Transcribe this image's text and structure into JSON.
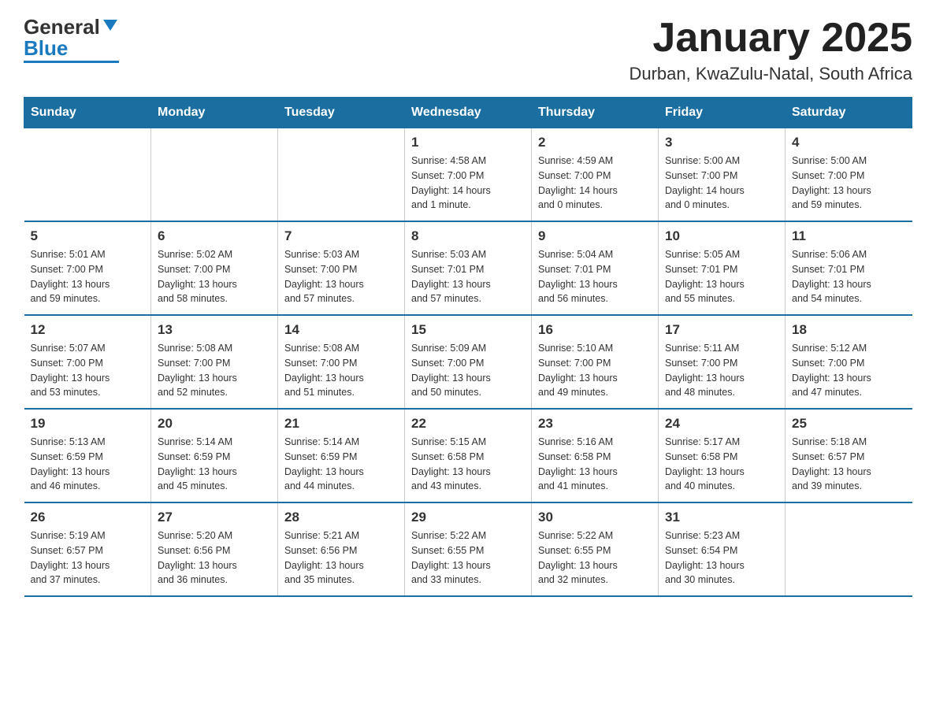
{
  "header": {
    "logo_text_general": "General",
    "logo_text_blue": "Blue",
    "title": "January 2025",
    "subtitle": "Durban, KwaZulu-Natal, South Africa"
  },
  "days_of_week": [
    "Sunday",
    "Monday",
    "Tuesday",
    "Wednesday",
    "Thursday",
    "Friday",
    "Saturday"
  ],
  "weeks": [
    [
      {
        "day": "",
        "info": ""
      },
      {
        "day": "",
        "info": ""
      },
      {
        "day": "",
        "info": ""
      },
      {
        "day": "1",
        "info": "Sunrise: 4:58 AM\nSunset: 7:00 PM\nDaylight: 14 hours\nand 1 minute."
      },
      {
        "day": "2",
        "info": "Sunrise: 4:59 AM\nSunset: 7:00 PM\nDaylight: 14 hours\nand 0 minutes."
      },
      {
        "day": "3",
        "info": "Sunrise: 5:00 AM\nSunset: 7:00 PM\nDaylight: 14 hours\nand 0 minutes."
      },
      {
        "day": "4",
        "info": "Sunrise: 5:00 AM\nSunset: 7:00 PM\nDaylight: 13 hours\nand 59 minutes."
      }
    ],
    [
      {
        "day": "5",
        "info": "Sunrise: 5:01 AM\nSunset: 7:00 PM\nDaylight: 13 hours\nand 59 minutes."
      },
      {
        "day": "6",
        "info": "Sunrise: 5:02 AM\nSunset: 7:00 PM\nDaylight: 13 hours\nand 58 minutes."
      },
      {
        "day": "7",
        "info": "Sunrise: 5:03 AM\nSunset: 7:00 PM\nDaylight: 13 hours\nand 57 minutes."
      },
      {
        "day": "8",
        "info": "Sunrise: 5:03 AM\nSunset: 7:01 PM\nDaylight: 13 hours\nand 57 minutes."
      },
      {
        "day": "9",
        "info": "Sunrise: 5:04 AM\nSunset: 7:01 PM\nDaylight: 13 hours\nand 56 minutes."
      },
      {
        "day": "10",
        "info": "Sunrise: 5:05 AM\nSunset: 7:01 PM\nDaylight: 13 hours\nand 55 minutes."
      },
      {
        "day": "11",
        "info": "Sunrise: 5:06 AM\nSunset: 7:01 PM\nDaylight: 13 hours\nand 54 minutes."
      }
    ],
    [
      {
        "day": "12",
        "info": "Sunrise: 5:07 AM\nSunset: 7:00 PM\nDaylight: 13 hours\nand 53 minutes."
      },
      {
        "day": "13",
        "info": "Sunrise: 5:08 AM\nSunset: 7:00 PM\nDaylight: 13 hours\nand 52 minutes."
      },
      {
        "day": "14",
        "info": "Sunrise: 5:08 AM\nSunset: 7:00 PM\nDaylight: 13 hours\nand 51 minutes."
      },
      {
        "day": "15",
        "info": "Sunrise: 5:09 AM\nSunset: 7:00 PM\nDaylight: 13 hours\nand 50 minutes."
      },
      {
        "day": "16",
        "info": "Sunrise: 5:10 AM\nSunset: 7:00 PM\nDaylight: 13 hours\nand 49 minutes."
      },
      {
        "day": "17",
        "info": "Sunrise: 5:11 AM\nSunset: 7:00 PM\nDaylight: 13 hours\nand 48 minutes."
      },
      {
        "day": "18",
        "info": "Sunrise: 5:12 AM\nSunset: 7:00 PM\nDaylight: 13 hours\nand 47 minutes."
      }
    ],
    [
      {
        "day": "19",
        "info": "Sunrise: 5:13 AM\nSunset: 6:59 PM\nDaylight: 13 hours\nand 46 minutes."
      },
      {
        "day": "20",
        "info": "Sunrise: 5:14 AM\nSunset: 6:59 PM\nDaylight: 13 hours\nand 45 minutes."
      },
      {
        "day": "21",
        "info": "Sunrise: 5:14 AM\nSunset: 6:59 PM\nDaylight: 13 hours\nand 44 minutes."
      },
      {
        "day": "22",
        "info": "Sunrise: 5:15 AM\nSunset: 6:58 PM\nDaylight: 13 hours\nand 43 minutes."
      },
      {
        "day": "23",
        "info": "Sunrise: 5:16 AM\nSunset: 6:58 PM\nDaylight: 13 hours\nand 41 minutes."
      },
      {
        "day": "24",
        "info": "Sunrise: 5:17 AM\nSunset: 6:58 PM\nDaylight: 13 hours\nand 40 minutes."
      },
      {
        "day": "25",
        "info": "Sunrise: 5:18 AM\nSunset: 6:57 PM\nDaylight: 13 hours\nand 39 minutes."
      }
    ],
    [
      {
        "day": "26",
        "info": "Sunrise: 5:19 AM\nSunset: 6:57 PM\nDaylight: 13 hours\nand 37 minutes."
      },
      {
        "day": "27",
        "info": "Sunrise: 5:20 AM\nSunset: 6:56 PM\nDaylight: 13 hours\nand 36 minutes."
      },
      {
        "day": "28",
        "info": "Sunrise: 5:21 AM\nSunset: 6:56 PM\nDaylight: 13 hours\nand 35 minutes."
      },
      {
        "day": "29",
        "info": "Sunrise: 5:22 AM\nSunset: 6:55 PM\nDaylight: 13 hours\nand 33 minutes."
      },
      {
        "day": "30",
        "info": "Sunrise: 5:22 AM\nSunset: 6:55 PM\nDaylight: 13 hours\nand 32 minutes."
      },
      {
        "day": "31",
        "info": "Sunrise: 5:23 AM\nSunset: 6:54 PM\nDaylight: 13 hours\nand 30 minutes."
      },
      {
        "day": "",
        "info": ""
      }
    ]
  ]
}
